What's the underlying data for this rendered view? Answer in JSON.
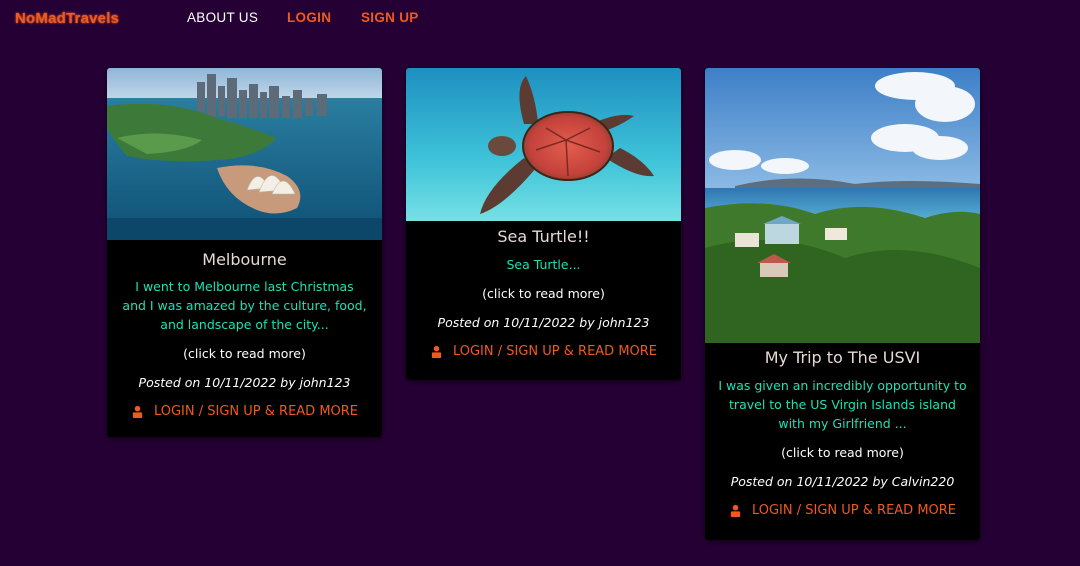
{
  "nav": {
    "brand": "NoMadTravels",
    "about": "ABOUT US",
    "login": "LOGIN",
    "signup": "SIGN UP"
  },
  "cards": [
    {
      "title": "Melbourne",
      "excerpt": "I went to Melbourne last Christmas and I was amazed by the culture, food, and landscape of the city...",
      "more": "(click to read more)",
      "posted": "Posted on 10/11/2022 by john123",
      "cta": "LOGIN / SIGN UP & READ MORE",
      "image": "harbour-city-photo"
    },
    {
      "title": "Sea Turtle!!",
      "excerpt": "Sea Turtle...",
      "more": "(click to read more)",
      "posted": "Posted on 10/11/2022 by john123",
      "cta": "LOGIN / SIGN UP & READ MORE",
      "image": "sea-turtle-photo"
    },
    {
      "title": "My Trip to The USVI",
      "excerpt": "I was given an incredibly opportunity to travel to the US Virgin Islands island with my Girlfriend ...",
      "more": "(click to read more)",
      "posted": "Posted on 10/11/2022 by Calvin220",
      "cta": "LOGIN / SIGN UP & READ MORE",
      "image": "island-view-photo"
    }
  ],
  "colors": {
    "background": "#250034",
    "accent": "#f05a1e",
    "excerpt": "#1fe0b3"
  }
}
